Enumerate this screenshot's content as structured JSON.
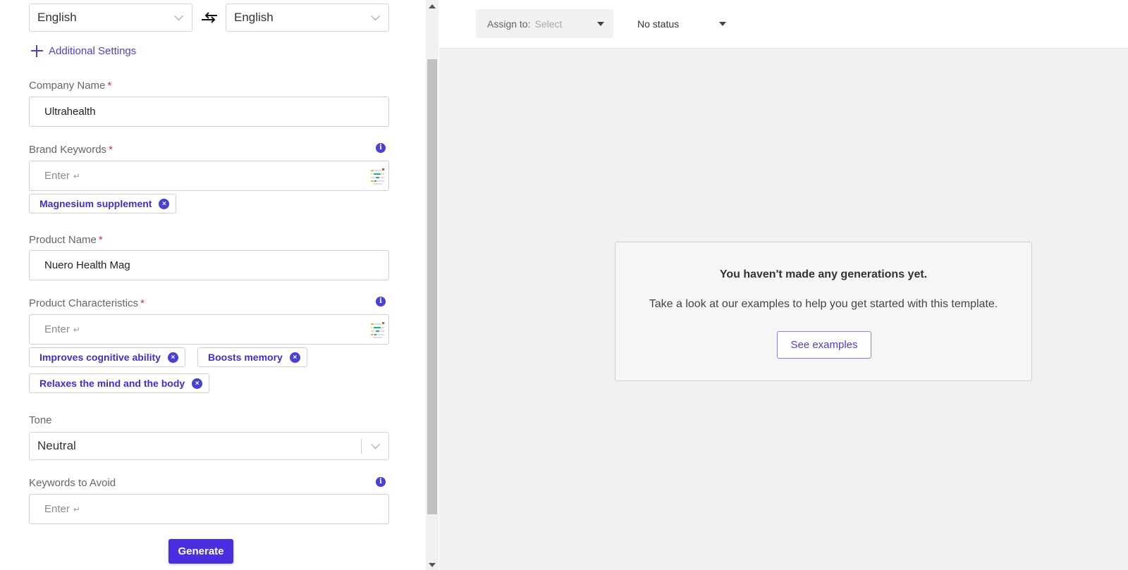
{
  "language": {
    "source": "English",
    "target": "English"
  },
  "additional_settings_label": "Additional Settings",
  "form": {
    "company_name": {
      "label": "Company Name",
      "required_mark": "*",
      "value": "Ultrahealth"
    },
    "brand_keywords": {
      "label": "Brand Keywords",
      "required_mark": "*",
      "placeholder": "Enter",
      "enter_glyph": "↵",
      "chips": [
        "Magnesium supplement"
      ]
    },
    "product_name": {
      "label": "Product Name",
      "required_mark": "*",
      "value": "Nuero Health Mag"
    },
    "product_characteristics": {
      "label": "Product Characteristics",
      "required_mark": "*",
      "placeholder": "Enter",
      "enter_glyph": "↵",
      "chips": [
        "Improves cognitive ability",
        "Boosts memory",
        "Relaxes the mind and the body"
      ]
    },
    "tone": {
      "label": "Tone",
      "value": "Neutral"
    },
    "keywords_to_avoid": {
      "label": "Keywords to Avoid",
      "placeholder": "Enter",
      "enter_glyph": "↵"
    },
    "info_glyph": "i",
    "chip_remove_glyph": "×"
  },
  "generate_label": "Generate",
  "toolbar": {
    "assign_label": "Assign to:",
    "assign_placeholder": "Select",
    "status_label": "No status"
  },
  "empty_state": {
    "title": "You haven't made any generations yet.",
    "message": "Take a look at our examples to help you get started with this template.",
    "button_label": "See examples"
  },
  "colors": {
    "accent": "#4a3fd6",
    "generate_button": "#4a2fe0",
    "required": "#e0283a",
    "panel_background": "#f1f1f1"
  },
  "icons": {
    "swap": "swap-languages-icon",
    "add": "plus-icon",
    "info": "info-icon",
    "keyword_suggest": "keyword-suggest-icon",
    "chip_remove": "remove-chip-icon",
    "dropdown": "chevron-down-icon",
    "caret": "caret-down-icon"
  }
}
